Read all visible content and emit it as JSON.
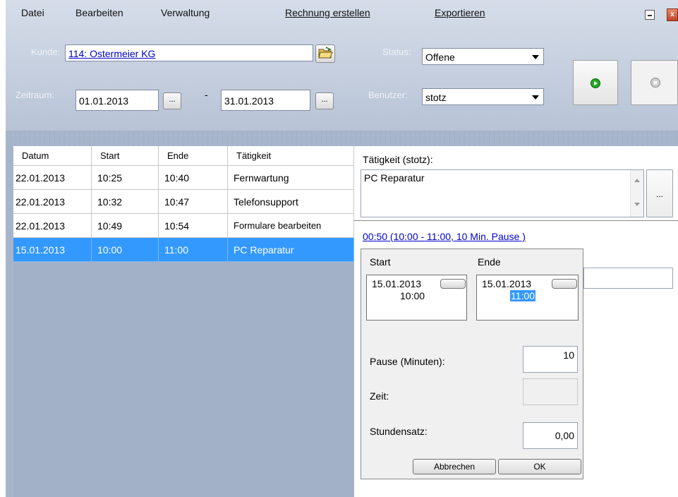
{
  "menu": {
    "datei": "Datei",
    "bearbeiten": "Bearbeiten",
    "verwaltung": "Verwaltung",
    "rechnung": "Rechnung erstellen",
    "exportieren": "Exportieren"
  },
  "filter": {
    "kunde_label": "Kunde:",
    "kunde_value": "114: Ostermeier KG",
    "status_label": "Status:",
    "status_value": "Offene",
    "zeitraum_label": "Zeitraum:",
    "date_from": "01.01.2013",
    "date_sep": "-",
    "date_to": "31.01.2013",
    "picker_label": "...",
    "benutzer_label": "Benutzer:",
    "benutzer_value": "stotz"
  },
  "grid": {
    "columns": [
      "Datum",
      "Start",
      "Ende",
      "Tätigkeit"
    ],
    "rows": [
      {
        "datum": "22.01.2013",
        "start": "10:25",
        "ende": "10:40",
        "taetigkeit": "Fernwartung"
      },
      {
        "datum": "22.01.2013",
        "start": "10:32",
        "ende": "10:47",
        "taetigkeit": "Telefonsupport"
      },
      {
        "datum": "22.01.2013",
        "start": "10:49",
        "ende": "10:54",
        "taetigkeit": "Formulare bearbeiten"
      },
      {
        "datum": "15.01.2013",
        "start": "10:00",
        "ende": "11:00",
        "taetigkeit": "PC Reparatur"
      }
    ],
    "selected_row": 3
  },
  "detail": {
    "taetigkeit_label": "Tätigkeit (stotz):",
    "taetigkeit_value": "PC Reparatur",
    "more_label": "...",
    "duration_link": "00:50 (10:00 - 11:00, 10 Min. Pause )"
  },
  "popup": {
    "start_label": "Start",
    "ende_label": "Ende",
    "start_date": "15.01.2013",
    "start_time": "10:00",
    "ende_date": "15.01.2013",
    "ende_time": "11:00",
    "pause_label": "Pause (Minuten):",
    "pause_value": "10",
    "zeit_label": "Zeit:",
    "zeit_value": "",
    "stundensatz_label": "Stundensatz:",
    "stundensatz_value": "0,00",
    "cancel_label": "Abbrechen",
    "ok_label": "OK"
  },
  "colors": {
    "selection": "#3399ff",
    "link": "#0000cc",
    "play_green": "#22aa22"
  },
  "icons": {
    "folder": "folder-open-icon",
    "play": "play-icon",
    "stop": "stop-icon",
    "minimize": "minimize-icon",
    "close": "close-icon"
  }
}
